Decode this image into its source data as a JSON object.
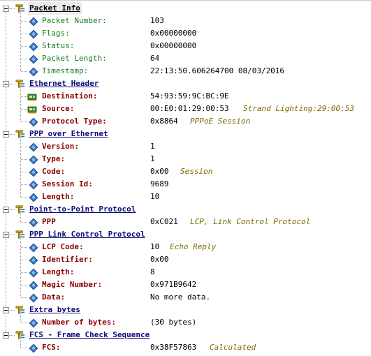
{
  "sections": [
    {
      "title": "Packet Info",
      "expanded": true,
      "field_style": "info",
      "fields": [
        {
          "name": "Packet Number:",
          "value": "103",
          "desc": "",
          "icon": "blue-diamond-icon"
        },
        {
          "name": "Flags:",
          "value": "0x00000000",
          "desc": "",
          "icon": "blue-diamond-icon"
        },
        {
          "name": "Status:",
          "value": "0x00000000",
          "desc": "",
          "icon": "blue-diamond-icon"
        },
        {
          "name": "Packet Length:",
          "value": "64",
          "desc": "",
          "icon": "blue-diamond-icon"
        },
        {
          "name": "Timestamp:",
          "value": "22:13:50.606264700 08/03/2016",
          "desc": "",
          "icon": "blue-diamond-icon"
        }
      ]
    },
    {
      "title": "Ethernet Header",
      "expanded": true,
      "field_style": "proto",
      "fields": [
        {
          "name": "Destination:",
          "value": "54:93:59:9C:BC:9E",
          "desc": "",
          "icon": "network-card-icon"
        },
        {
          "name": "Source:",
          "value": "00:E0:01:29:00:53",
          "desc": "Strand Lighting:29:00:53",
          "icon": "network-card-icon"
        },
        {
          "name": "Protocol Type:",
          "value": "0x8864",
          "desc": "PPPoE Session",
          "icon": "blue-diamond-icon"
        }
      ]
    },
    {
      "title": "PPP over Ethernet",
      "expanded": true,
      "field_style": "proto",
      "fields": [
        {
          "name": "Version:",
          "value": "1",
          "desc": "",
          "icon": "blue-diamond-icon"
        },
        {
          "name": "Type:",
          "value": "1",
          "desc": "",
          "icon": "blue-diamond-icon"
        },
        {
          "name": "Code:",
          "value": "0x00",
          "desc": "Session",
          "icon": "blue-diamond-icon"
        },
        {
          "name": "Session Id:",
          "value": "9689",
          "desc": "",
          "icon": "blue-diamond-icon"
        },
        {
          "name": "Length:",
          "value": "10",
          "desc": "",
          "icon": "blue-diamond-icon"
        }
      ]
    },
    {
      "title": "Point-to-Point Protocol",
      "expanded": true,
      "field_style": "proto",
      "fields": [
        {
          "name": "PPP",
          "value": "0xC021",
          "desc": "LCP, Link Control Protocol",
          "icon": "blue-diamond-icon"
        }
      ]
    },
    {
      "title": "PPP Link Control Protocol",
      "expanded": true,
      "field_style": "proto",
      "fields": [
        {
          "name": "LCP Code:",
          "value": "10",
          "desc": "Echo Reply",
          "icon": "blue-diamond-icon"
        },
        {
          "name": "Identifier:",
          "value": "0x00",
          "desc": "",
          "icon": "blue-diamond-icon"
        },
        {
          "name": "Length:",
          "value": "8",
          "desc": "",
          "icon": "blue-diamond-icon"
        },
        {
          "name": "Magic Number:",
          "value": "0x971B9642",
          "desc": "",
          "icon": "blue-diamond-icon"
        },
        {
          "name": "Data:",
          "value": "No more data.",
          "desc": "",
          "icon": "blue-diamond-icon"
        }
      ]
    },
    {
      "title": "Extra bytes",
      "expanded": true,
      "field_style": "proto",
      "fields": [
        {
          "name": "Number of bytes:",
          "value": "(30 bytes)",
          "desc": "",
          "icon": "blue-diamond-icon"
        }
      ]
    },
    {
      "title": "FCS - Frame Check Sequence",
      "expanded": true,
      "field_style": "proto",
      "fields": [
        {
          "name": "FCS:",
          "value": "0x38F57863",
          "desc": "Calculated",
          "icon": "blue-diamond-icon"
        }
      ]
    }
  ],
  "colors": {
    "section_title": "#0a0a7a",
    "info_field": "#1b7d1b",
    "proto_field": "#8b0000",
    "description": "#7a6a00",
    "icon_blue": "#3a78c4"
  }
}
